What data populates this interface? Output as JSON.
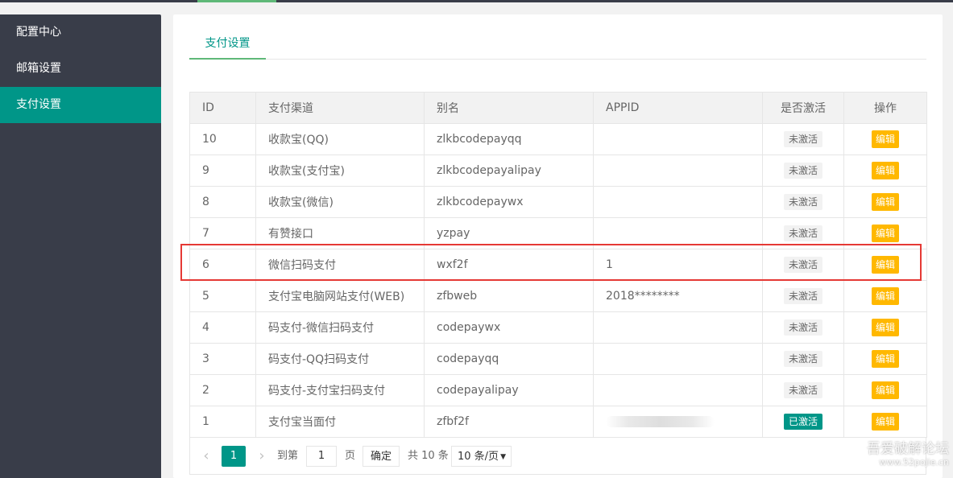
{
  "sidebar": {
    "items": [
      {
        "label": "配置中心",
        "active": false
      },
      {
        "label": "邮箱设置",
        "active": false
      },
      {
        "label": "支付设置",
        "active": true
      }
    ]
  },
  "tabs": [
    {
      "label": "支付设置",
      "active": true
    }
  ],
  "table": {
    "headers": {
      "id": "ID",
      "channel": "支付渠道",
      "alias": "别名",
      "appid": "APPID",
      "active": "是否激活",
      "action": "操作"
    },
    "rows": [
      {
        "id": "10",
        "channel": "收款宝(QQ)",
        "alias": "zlkbcodepayqq",
        "appid": "",
        "status": "未激活",
        "action": "编辑"
      },
      {
        "id": "9",
        "channel": "收款宝(支付宝)",
        "alias": "zlkbcodepayalipay",
        "appid": "",
        "status": "未激活",
        "action": "编辑"
      },
      {
        "id": "8",
        "channel": "收款宝(微信)",
        "alias": "zlkbcodepaywx",
        "appid": "",
        "status": "未激活",
        "action": "编辑"
      },
      {
        "id": "7",
        "channel": "有赞接口",
        "alias": "yzpay",
        "appid": "",
        "status": "未激活",
        "action": "编辑"
      },
      {
        "id": "6",
        "channel": "微信扫码支付",
        "alias": "wxf2f",
        "appid": "1",
        "status": "未激活",
        "action": "编辑"
      },
      {
        "id": "5",
        "channel": "支付宝电脑网站支付(WEB)",
        "alias": "zfbweb",
        "appid": "2018********",
        "status": "未激活",
        "action": "编辑"
      },
      {
        "id": "4",
        "channel": "码支付-微信扫码支付",
        "alias": "codepaywx",
        "appid": "",
        "status": "未激活",
        "action": "编辑"
      },
      {
        "id": "3",
        "channel": "码支付-QQ扫码支付",
        "alias": "codepayqq",
        "appid": "",
        "status": "未激活",
        "action": "编辑"
      },
      {
        "id": "2",
        "channel": "码支付-支付宝扫码支付",
        "alias": "codepayalipay",
        "appid": "",
        "status": "未激活",
        "action": "编辑"
      },
      {
        "id": "1",
        "channel": "支付宝当面付",
        "alias": "zfbf2f",
        "appid": "",
        "status": "已激活",
        "action": "编辑",
        "appid_blurred": true
      }
    ]
  },
  "pagination": {
    "prev": "‹",
    "current": "1",
    "next": "›",
    "goto_prefix": "到第",
    "goto_value": "1",
    "goto_suffix": "页",
    "confirm": "确定",
    "total": "共 10 条",
    "page_size": "10 条/页"
  },
  "watermark": {
    "title": "吾爱破解论坛",
    "url": "www.52pojie.cn"
  },
  "colors": {
    "sidebar": "#393d49",
    "accent": "#009688",
    "edit": "#ffb800",
    "highlight": "#e53935"
  }
}
